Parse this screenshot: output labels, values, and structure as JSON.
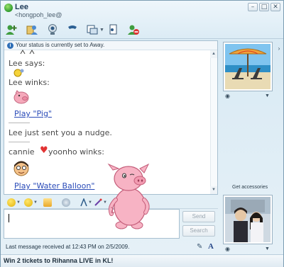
{
  "titlebar": {
    "name": "Lee",
    "email": "<hongpoh_lee@",
    "controls": [
      "–",
      "□",
      "✕"
    ]
  },
  "toolbar": {
    "icons": [
      "invite-contact-icon",
      "share-files-icon",
      "video-call-icon",
      "phone-call-icon",
      "activities-icon",
      "games-icon",
      "block-contact-icon"
    ]
  },
  "chat": {
    "status_notice": "Your status is currently set to Away.",
    "lines": {
      "lee_says": "Lee says:",
      "lee_winks": "Lee winks:",
      "play_pig": "Play \"Pig\"",
      "nudge": "Lee just sent you a nudge.",
      "cannie": "cannie",
      "yoonho_winks": "yoonho winks:",
      "play_water_balloon": "Play \"Water Balloon\""
    },
    "heart": "♥"
  },
  "compose": {
    "send_label": "Send",
    "search_label": "Search",
    "input_value": ""
  },
  "status_line": "Last message received at 12:43 PM on 2/5/2009.",
  "ad_text": "Win 2 tickets to Rihanna LIVE in KL!",
  "sidebar": {
    "get_accessories": "Get accessories",
    "collapse_glyph": "›"
  },
  "colors": {
    "link": "#2a4bb8",
    "heart": "#e23333",
    "pig": "#f4a6b8"
  }
}
